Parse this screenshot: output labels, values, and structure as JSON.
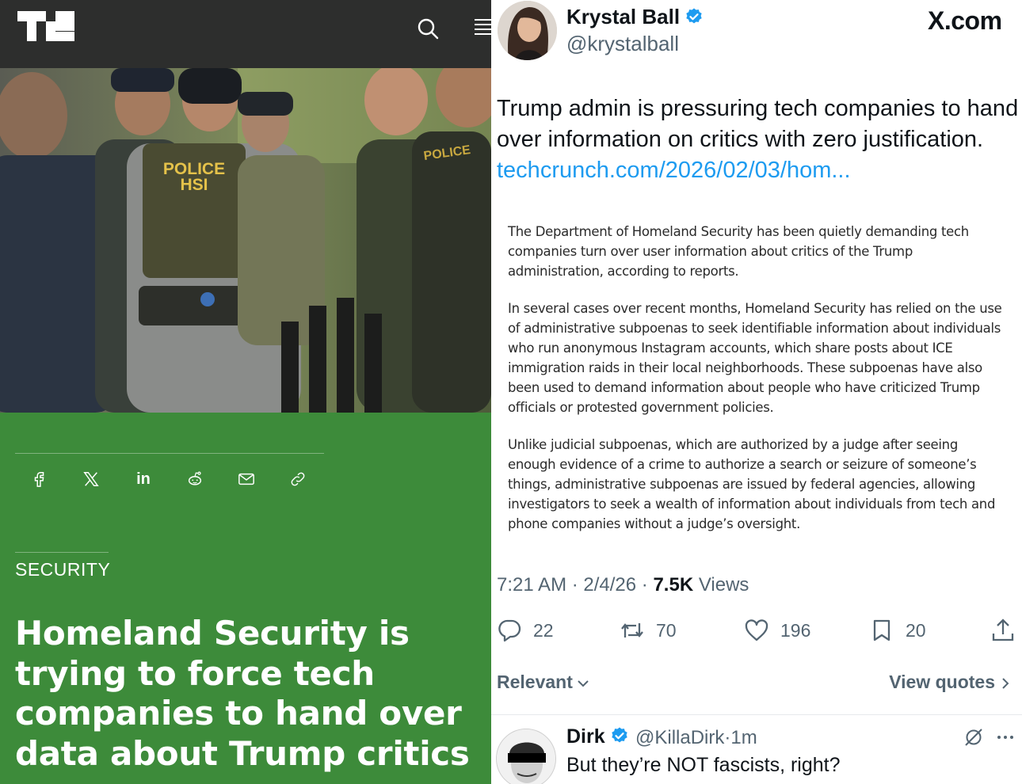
{
  "article": {
    "logo_text": "TC",
    "photo_vest_text_line1": "POLICE",
    "photo_vest_text_line2": "HSI",
    "photo_vest_text_right": "POLICE",
    "share_icons": [
      "facebook-icon",
      "x-icon",
      "linkedin-icon",
      "reddit-icon",
      "email-icon",
      "link-icon"
    ],
    "linkedin_label": "in",
    "category": "SECURITY",
    "headline": "Homeland Security is trying to force tech companies to hand over data about Trump critics",
    "colors": {
      "header_bg": "#2d2e2d",
      "body_bg": "#3d8b3a",
      "text": "#ffffff"
    }
  },
  "post": {
    "author_name": "Krystal Ball",
    "author_handle": "@krystalball",
    "brand": "X.com",
    "text": "Trump admin is pressuring tech companies to hand over information on critics with zero justification.",
    "link": "techcrunch.com/2026/02/03/hom...",
    "excerpt": [
      "The Department of Homeland Security has been quietly demanding tech companies turn over user information about critics of the Trump administration, according to reports.",
      "In several cases over recent months, Homeland Security has relied on the use of administrative subpoenas to seek identifiable information about individuals who run anonymous Instagram accounts, which share posts about ICE immigration raids in their local neighborhoods. These subpoenas have also been used to demand information about people who have criticized Trump officials or protested government policies.",
      "Unlike judicial subpoenas, which are authorized by a judge after seeing enough evidence of a crime to authorize a search or seizure of someone’s things, administrative subpoenas are issued by federal agencies, allowing investigators to seek a wealth of information about individuals from tech and phone companies without a judge’s oversight."
    ],
    "time": "7:21 AM",
    "date": "2/4/26",
    "views_count": "7.5K",
    "views_label": "Views",
    "replies": "22",
    "reposts": "70",
    "likes": "196",
    "bookmarks": "20",
    "sort_label": "Relevant",
    "view_quotes_label": "View quotes",
    "colors": {
      "link": "#1d9bf0",
      "verified": "#1d9bf0",
      "muted": "#536471"
    }
  },
  "reply": {
    "name": "Dirk",
    "handle": "@KillaDirk",
    "separator": "·",
    "time": "1m",
    "text": "But they’re NOT fascists, right?"
  }
}
